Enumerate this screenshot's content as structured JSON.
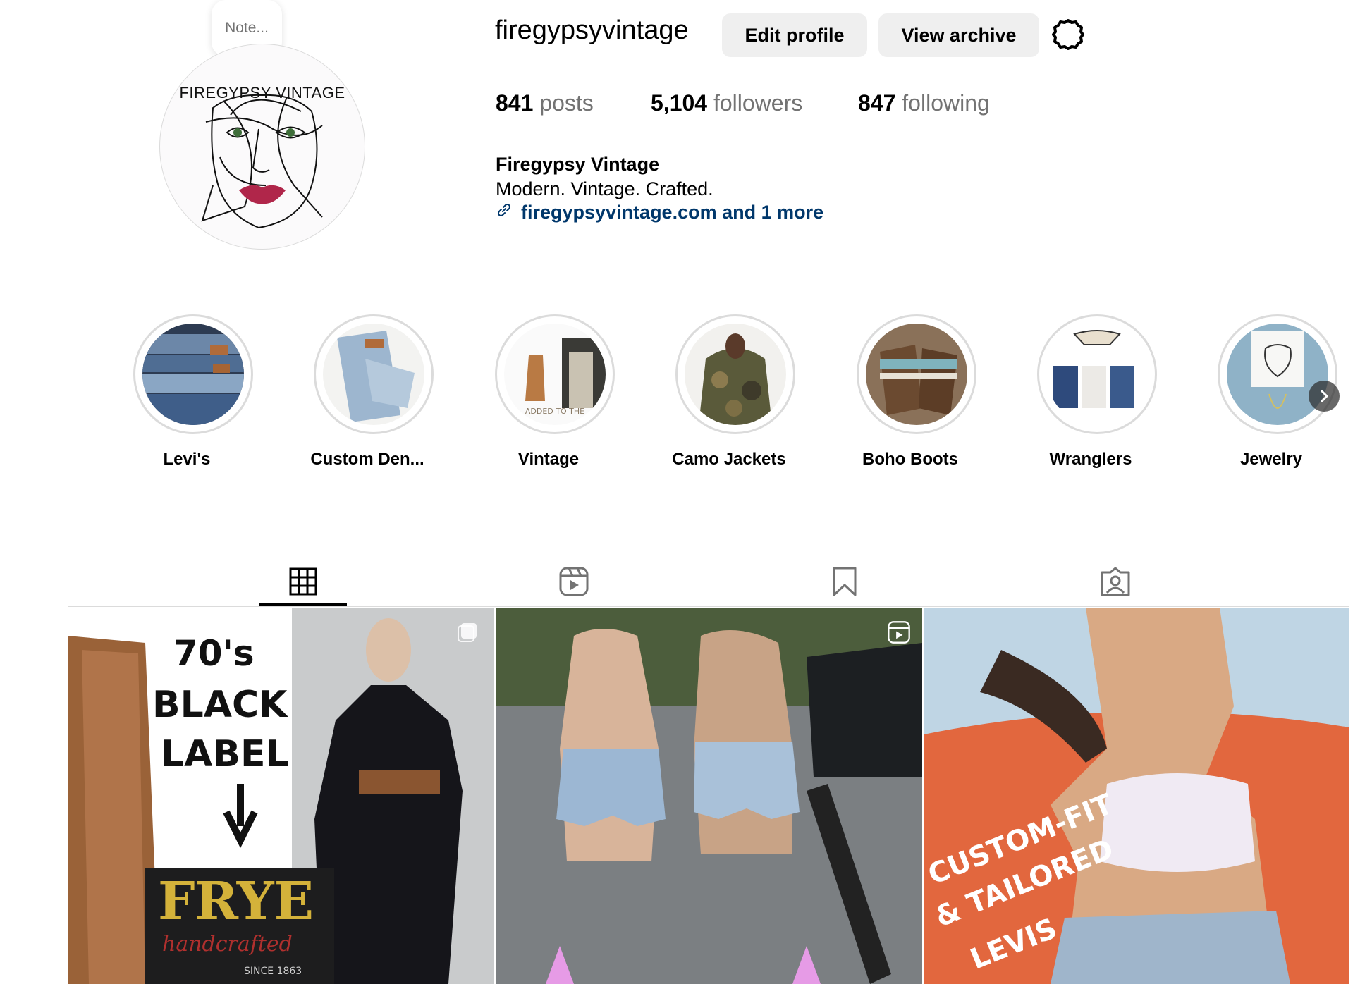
{
  "profile": {
    "note_placeholder": "Note...",
    "avatar_text": "FIREGYPSY VINTAGE",
    "username": "firegypsyvintage",
    "edit_profile_label": "Edit profile",
    "view_archive_label": "View archive",
    "settings_icon": "gear-icon",
    "stats": {
      "posts_count": "841",
      "posts_label": "posts",
      "followers_count": "5,104",
      "followers_label": "followers",
      "following_count": "847",
      "following_label": "following"
    },
    "bio": {
      "name": "Firegypsy Vintage",
      "tagline": "Modern. Vintage. Crafted.",
      "link_text": "firegypsyvintage.com and 1 more",
      "link_icon": "link-icon"
    }
  },
  "highlights": [
    {
      "label": "Levi's"
    },
    {
      "label": "Custom Den..."
    },
    {
      "label": "Vintage",
      "image_text": "ADDED TO THE"
    },
    {
      "label": "Camo Jackets"
    },
    {
      "label": "Boho Boots"
    },
    {
      "label": "Wranglers"
    },
    {
      "label": "Jewelry"
    }
  ],
  "tabs": [
    {
      "name": "posts",
      "icon": "grid-icon",
      "active": true
    },
    {
      "name": "reels",
      "icon": "reels-icon",
      "active": false
    },
    {
      "name": "saved",
      "icon": "bookmark-icon",
      "active": false
    },
    {
      "name": "tagged",
      "icon": "tagged-icon",
      "active": false
    }
  ],
  "posts": [
    {
      "type": "carousel",
      "overlay_text": [
        "70's",
        "BLACK",
        "LABEL"
      ],
      "brand_text": "FRYE",
      "script_text": "handcrafted",
      "since_text": "SINCE 1863"
    },
    {
      "type": "reel"
    },
    {
      "type": "image",
      "overlay_text": [
        "CUSTOM-FIT",
        "& TAILORED",
        "LEVIS"
      ]
    }
  ],
  "colors": {
    "link": "#00376b",
    "muted": "#737373",
    "button_bg": "#efefef",
    "border": "#dbdbdb"
  }
}
